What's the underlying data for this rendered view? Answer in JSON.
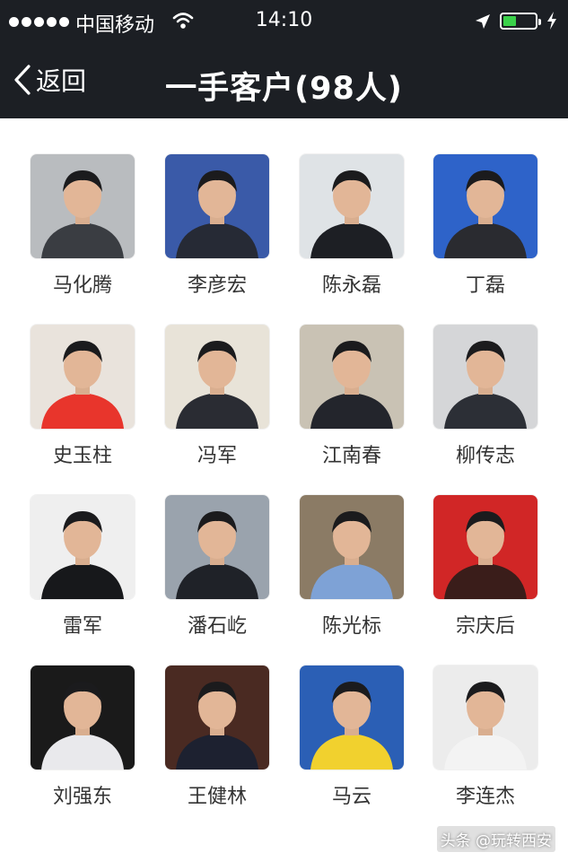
{
  "status_bar": {
    "carrier": "中国移动",
    "time": "14:10",
    "battery_level": 0.4,
    "signal_dots": 5
  },
  "nav": {
    "back_label": "返回",
    "title": "一手客户(98人)"
  },
  "contacts": [
    {
      "name": "马化腾",
      "bg": "#b9bcbf",
      "shirt": "#3a3d42"
    },
    {
      "name": "李彦宏",
      "bg": "#3a5aa8",
      "shirt": "#262a35"
    },
    {
      "name": "陈永磊",
      "bg": "#dfe3e6",
      "shirt": "#1d1f24"
    },
    {
      "name": "丁磊",
      "bg": "#2e63c9",
      "shirt": "#2a2b30"
    },
    {
      "name": "史玉柱",
      "bg": "#e9e3dc",
      "shirt": "#e8352c"
    },
    {
      "name": "冯军",
      "bg": "#e8e3d8",
      "shirt": "#2a2c33"
    },
    {
      "name": "江南春",
      "bg": "#c9c2b4",
      "shirt": "#23252c"
    },
    {
      "name": "柳传志",
      "bg": "#d5d6d8",
      "shirt": "#2c2f36"
    },
    {
      "name": "雷军",
      "bg": "#efefef",
      "shirt": "#17181b"
    },
    {
      "name": "潘石屹",
      "bg": "#9aa3ad",
      "shirt": "#1f2228"
    },
    {
      "name": "陈光标",
      "bg": "#8b7b65",
      "shirt": "#7ea2d6"
    },
    {
      "name": "宗庆后",
      "bg": "#d12626",
      "shirt": "#3a1d1a"
    },
    {
      "name": "刘强东",
      "bg": "#1a1a1a",
      "shirt": "#e9e9ec"
    },
    {
      "name": "王健林",
      "bg": "#4a2a22",
      "shirt": "#1d2130"
    },
    {
      "name": "马云",
      "bg": "#2b5fb5",
      "shirt": "#f1d12e"
    },
    {
      "name": "李连杰",
      "bg": "#ececec",
      "shirt": "#f3f3f3"
    }
  ],
  "watermark": "头条 @玩转西安"
}
